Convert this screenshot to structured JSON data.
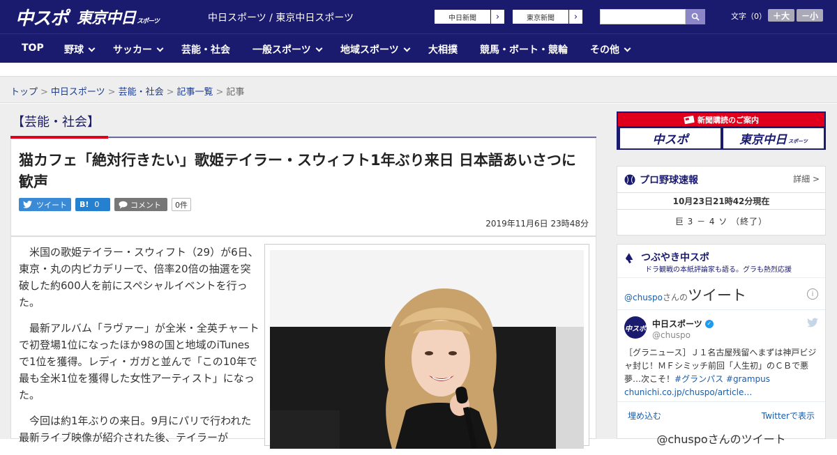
{
  "header": {
    "logo_chunichi": "中スポ",
    "logo_tokyo": "東京中日",
    "logo_tokyo_suffix": "スポーツ",
    "site_links": "中日スポーツ / 東京中日スポーツ",
    "paper_buttons": [
      "中日新聞",
      "東京新聞"
    ],
    "search_placeholder": "",
    "text_size_label": "文字（0）",
    "size_up": "＋大",
    "size_down": "－小"
  },
  "nav": {
    "items": [
      "TOP",
      "野球",
      "サッカー",
      "芸能・社会",
      "一般スポーツ",
      "地域スポーツ",
      "大相撲",
      "競馬・ボート・競輪",
      "その他"
    ]
  },
  "breadcrumb": {
    "items": [
      "トップ",
      "中日スポーツ",
      "芸能・社会",
      "記事一覧"
    ],
    "current": "記事"
  },
  "article": {
    "category": "【芸能・社会】",
    "headline": "猫カフェ「絶対行きたい」歌姫テイラー・スウィフト1年ぶり来日 日本語あいさつに歓声",
    "tweet_label": "ツイート",
    "hatena_label": "B!",
    "hatena_count": "0",
    "comment_label": "コメント",
    "comment_count": "0件",
    "date": "2019年11月6日 23時48分",
    "paragraphs": [
      "米国の歌姫テイラー・スウィフト（29）が6日、東京・丸の内ピカデリーで、倍率20倍の抽選を突破した約600人を前にスペシャルイベントを行った。",
      "最新アルバム「ラヴァー」が全米・全英チャートで初登場1位になったほか98の国と地域のiTunesで1位を獲得。レディ・ガガと並んで「この10年で最も全米1位を獲得した女性アーティスト」になった。",
      "今回は約1年ぶりの来日。9月にパリで行われた最新ライブ映像が紹介された後、テイラーが"
    ]
  },
  "sidebar": {
    "subscribe_banner": "新聞購読のご案内",
    "sub_logo_1": "中スポ",
    "sub_logo_2": "東京中日",
    "sub_logo_2_suffix": "スポーツ",
    "baseball": {
      "title": "プロ野球速報",
      "more": "詳細 >",
      "time": "10月23日21時42分現在",
      "score": "巨 3 － 4 ソ （終了）"
    },
    "tsubuyaki": {
      "title": "つぶやき中スポ",
      "subtitle": "ドラ観戦の本紙評論家も語る。グラも熱烈応援",
      "tweets_handle": "@chuspo",
      "tweets_san": "さんの",
      "tweets_word": "ツイート",
      "account_name": "中日スポーツ",
      "account_handle": "@chuspo",
      "avatar_text": "中スポ",
      "tweet_text": "［グラニュース］Ｊ１名古屋残留へまずは神戸ビジャ封じ！ＭＦシミッチ前回「人生初」のＣＢで悪夢…次こそ！",
      "tweet_tags": "#グランパス #grampus",
      "tweet_link": "chunichi.co.jp/chuspo/article…",
      "embed": "埋め込む",
      "view_on_twitter": "Twitterで表示",
      "footer": "@chuspoさんのツイート"
    }
  }
}
